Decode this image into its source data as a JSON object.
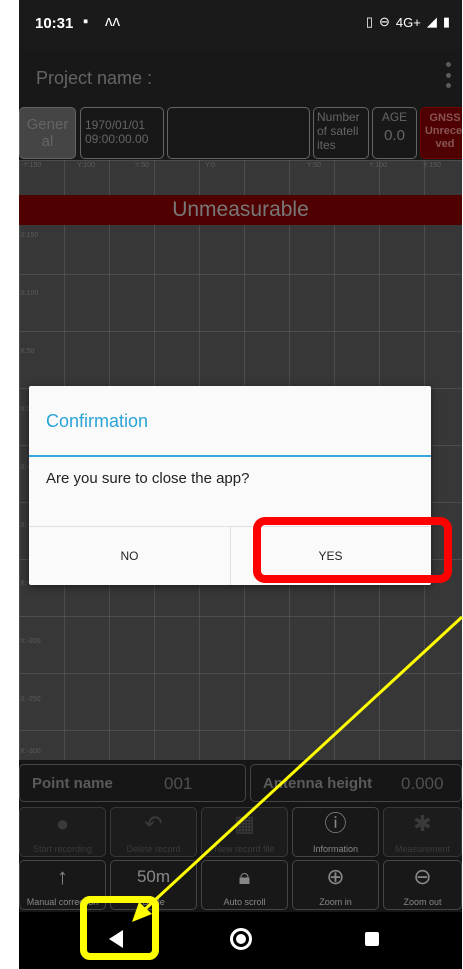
{
  "status_bar": {
    "time": "10:31",
    "network": "4G+",
    "icons": [
      "photo-icon",
      "notification-icon",
      "vibrate-icon",
      "dnd-icon",
      "signal-icon",
      "battery-icon"
    ]
  },
  "app_bar": {
    "title": "Project name :"
  },
  "info": {
    "general": "General",
    "date": "1970/01/01",
    "time": "09:00:00.00",
    "sats_label": "Number of satellites",
    "age_label": "AGE",
    "age_value": "0.0",
    "gnss_label": "GNSS",
    "gnss_status": "Unreceived"
  },
  "graph": {
    "x_ticks": [
      "-Y:150",
      "Y:100",
      "Y:50",
      "Y:0",
      "Y:50",
      "Y:100",
      "Y:150"
    ],
    "y_ticks": [
      "X:150",
      "X:100",
      "X:50",
      "X:0",
      "X:-50",
      "X:-100",
      "X:-150",
      "X:-200",
      "X:-250",
      "X:-300"
    ],
    "banner": "Unmeasurable"
  },
  "point": {
    "name_label": "Point name",
    "name_value": "001",
    "antenna_label": "Antenna height",
    "antenna_value": "0.000"
  },
  "buttons_row1": [
    {
      "label": "Start recording",
      "icon": "record-icon"
    },
    {
      "label": "Delete record",
      "icon": "undo-icon"
    },
    {
      "label": "New record file",
      "icon": "file-icon"
    },
    {
      "label": "Information",
      "icon": "info-icon"
    },
    {
      "label": "Measurement",
      "icon": "gear-icon"
    }
  ],
  "buttons_row2": [
    {
      "label": "Manual correction",
      "icon": "arrow-up-icon"
    },
    {
      "label": "Scale",
      "value": "50m",
      "icon": "scale-icon"
    },
    {
      "label": "Auto scroll",
      "icon": "lock-icon"
    },
    {
      "label": "Zoom in",
      "icon": "zoom-in-icon"
    },
    {
      "label": "Zoom out",
      "icon": "zoom-out-icon"
    }
  ],
  "dialog": {
    "title": "Confirmation",
    "message": "Are you sure to close the app?",
    "no_label": "NO",
    "yes_label": "YES"
  },
  "annotations": {
    "highlight_color_yes": "#ff0000",
    "highlight_color_back": "#ffff00",
    "arrow_color": "#ffff00"
  }
}
